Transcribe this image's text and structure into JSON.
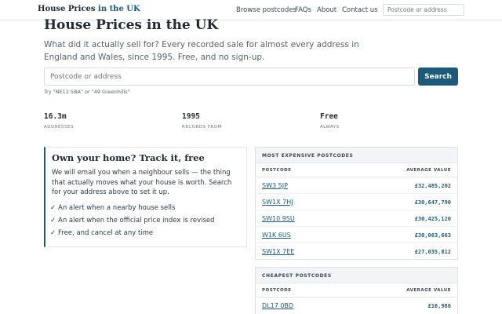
{
  "header": {
    "logo_part1": "House Prices",
    "logo_part2": "in the UK",
    "nav": [
      "Browse postcodes",
      "FAQs",
      "About",
      "Contact us"
    ],
    "search_placeholder": "Postcode or address"
  },
  "hero": {
    "title": "House Prices in the UK",
    "subtitle": "What did it actually sell for? Every recorded sale for almost every address in England and Wales, since 1995. Free, and no sign-up.",
    "search_placeholder": "Postcode or address",
    "search_button": "Search",
    "hint": "Try \"NE12 5BA\" or \"49 Greenhills\""
  },
  "stats": [
    {
      "value": "16.3m",
      "label": "ADDRESSES"
    },
    {
      "value": "1995",
      "label": "RECORDS FROM"
    },
    {
      "value": "Free",
      "label": "ALWAYS"
    }
  ],
  "track": {
    "title": "Own your home? Track it, free",
    "text": "We will email you when a neighbour sells — the thing that actually moves what your house is worth. Search for your address above to set it up.",
    "items": [
      "An alert when a nearby house sells",
      "An alert when the official price index is revised",
      "Free, and cancel at any time"
    ]
  },
  "expensive": {
    "title": "MOST EXPENSIVE POSTCODES",
    "col_postcode": "POSTCODE",
    "col_value": "AVERAGE VALUE",
    "rows": [
      {
        "postcode": "SW3 5JP",
        "value": "£32,485,202"
      },
      {
        "postcode": "SW1X 7HJ",
        "value": "£30,647,790"
      },
      {
        "postcode": "SW10 9SU",
        "value": "£30,425,120"
      },
      {
        "postcode": "W1K 6US",
        "value": "£30,063,663"
      },
      {
        "postcode": "SW1X 7EE",
        "value": "£27,035,812"
      }
    ]
  },
  "cheapest": {
    "title": "CHEAPEST POSTCODES",
    "col_postcode": "POSTCODE",
    "col_value": "AVERAGE VALUE",
    "rows": [
      {
        "postcode": "DL17 0BD",
        "value": "£16,986"
      }
    ]
  }
}
